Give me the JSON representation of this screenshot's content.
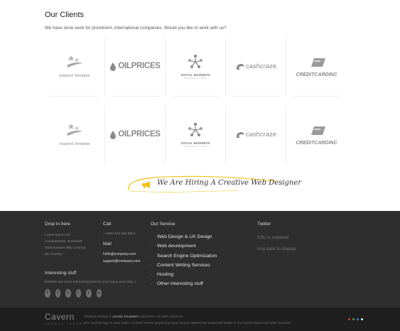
{
  "clients": {
    "title": "Our Clients",
    "intro": "We have done work for prominent, international companies. Would you like to work with us?",
    "logos": {
      "inspired": "Inspired Template",
      "oilprices": "OILPRICES",
      "social_business": "SOCIAL BUSINESS",
      "social_business_sub": "CONSULTING",
      "cashcraze": "cashcraze",
      "creditcard": "CREDITCARDINC"
    }
  },
  "hiring": {
    "text": "We Are Hiring A Creative Web Designer"
  },
  "footer": {
    "drop": {
      "heading": "Drop in here",
      "address": [
        "Lorem Ipsum DC",
        "Ameliorsestet, Northfield",
        "2456 Eastern Billy (county)",
        "My Country"
      ],
      "interesting_heading": "Interesting stuff",
      "interesting_desc": "Besides are some interesting links for you! Enjoy your stay :)"
    },
    "call": {
      "heading": "Call",
      "phone": "+ 1800 123 456 8001",
      "mail_heading": "Mail",
      "emails": [
        "hello@company.com",
        "support@company.com"
      ]
    },
    "service": {
      "heading": "Our Service",
      "items": [
        "Web Design & UX Design",
        "Web development",
        "Search Engine Optimization",
        "Content Writing Services",
        "Hosting",
        "Other interesting stuff"
      ]
    },
    "twitter": {
      "heading": "Twitter",
      "ssl": "SSL is required",
      "nodata": "Any data to display"
    },
    "socials": [
      "f",
      "t",
      "t",
      "r",
      "i",
      "v"
    ]
  },
  "bottom": {
    "brand": "Cavern",
    "tagline": "JOOMLA THEMES",
    "copy_prefix": "Template Design ©",
    "copy_link": "Joomla Templates",
    "copy_suffix": "GavickPro. All rights reserved.",
    "copy_line2": "The Joomla! logo is used under a limited license granted by Open Source Matters the trademark holder in the United States and other countries."
  },
  "colors": {
    "footer_bg": "#2e2e2e",
    "bottom_bg": "#1f1f1f",
    "accent": "#f2c21b",
    "dots": [
      "#e53935",
      "#43a047",
      "#1e88e5",
      "#eeeeee"
    ]
  }
}
